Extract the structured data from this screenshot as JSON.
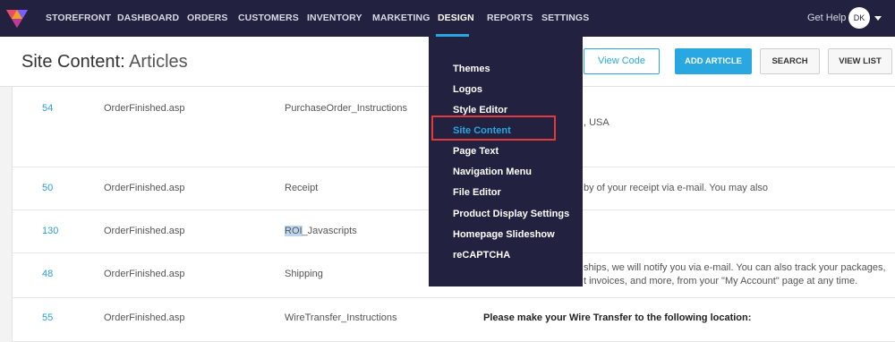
{
  "nav": {
    "items": [
      "STOREFRONT",
      "DASHBOARD",
      "ORDERS",
      "CUSTOMERS",
      "INVENTORY",
      "MARKETING",
      "DESIGN",
      "REPORTS",
      "SETTINGS"
    ],
    "active": "DESIGN",
    "get_help": "Get Help",
    "avatar_initials": "DK"
  },
  "header": {
    "title_bold": "Site Content:",
    "title_light": "Articles",
    "buttons": {
      "view_code": "View Code",
      "add_article": "ADD ARTICLE",
      "search": "SEARCH",
      "view_list": "VIEW LIST"
    }
  },
  "rows": [
    {
      "id": "54",
      "page": "OrderFinished.asp",
      "name": "PurchaseOrder_Instructions",
      "text": ", USA"
    },
    {
      "id": "50",
      "page": "OrderFinished.asp",
      "name": "Receipt",
      "text": "by of your receipt via e-mail. You may also"
    },
    {
      "id": "130",
      "page": "OrderFinished.asp",
      "name_highlight": "ROI",
      "name_rest": "_Javascripts",
      "text": ""
    },
    {
      "id": "48",
      "page": "OrderFinished.asp",
      "name": "Shipping",
      "text": "ships, we will notify you via e-mail. You can also track your packages,",
      "text2": "t invoices, and more, from your \"My Account\" page at any time."
    },
    {
      "id": "55",
      "page": "OrderFinished.asp",
      "name": "WireTransfer_Instructions",
      "text": "Please make your Wire Transfer to the following location:"
    }
  ],
  "dropdown": {
    "items": [
      "Themes",
      "Logos",
      "Style Editor",
      "Site Content",
      "Page Text",
      "Navigation Menu",
      "File Editor",
      "Product Display Settings",
      "Homepage Slideshow",
      "reCAPTCHA"
    ],
    "current": "Site Content"
  },
  "colors": {
    "nav_bg": "#222140",
    "accent": "#29a7e1",
    "highlight_box": "#e03a3a"
  }
}
